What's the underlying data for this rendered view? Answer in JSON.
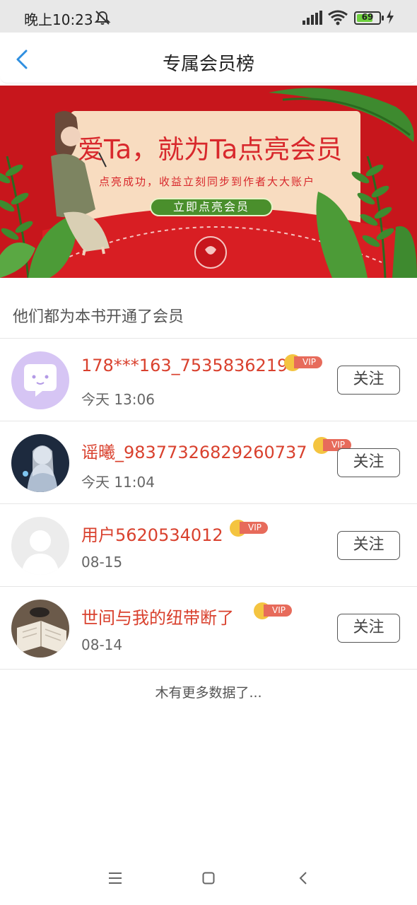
{
  "status_bar": {
    "time": "晚上10:23",
    "battery": "69"
  },
  "nav": {
    "title": "专属会员榜"
  },
  "banner": {
    "headline": "爱Ta，就为Ta点亮会员",
    "subline": "点亮成功，收益立刻同步到作者大大账户",
    "cta": "立即点亮会员"
  },
  "section": {
    "title": "他们都为本书开通了会员"
  },
  "vip_label": "VIP",
  "members": [
    {
      "name": "178***163_7535836219",
      "time": "今天 13:06",
      "follow": "关注"
    },
    {
      "name": "谣曦_98377326829260737",
      "time": "今天 11:04",
      "follow": "关注"
    },
    {
      "name": "用户5620534012",
      "time": "08-15",
      "follow": "关注"
    },
    {
      "name": "世间与我的纽带断了",
      "time": "08-14",
      "follow": "关注"
    }
  ],
  "footer": {
    "no_more": "木有更多数据了..."
  },
  "colors": {
    "accent_blue": "#2f8fe0",
    "name_red": "#d9412e",
    "banner_red": "#c7161c",
    "cta_green": "#4a8f2c"
  }
}
